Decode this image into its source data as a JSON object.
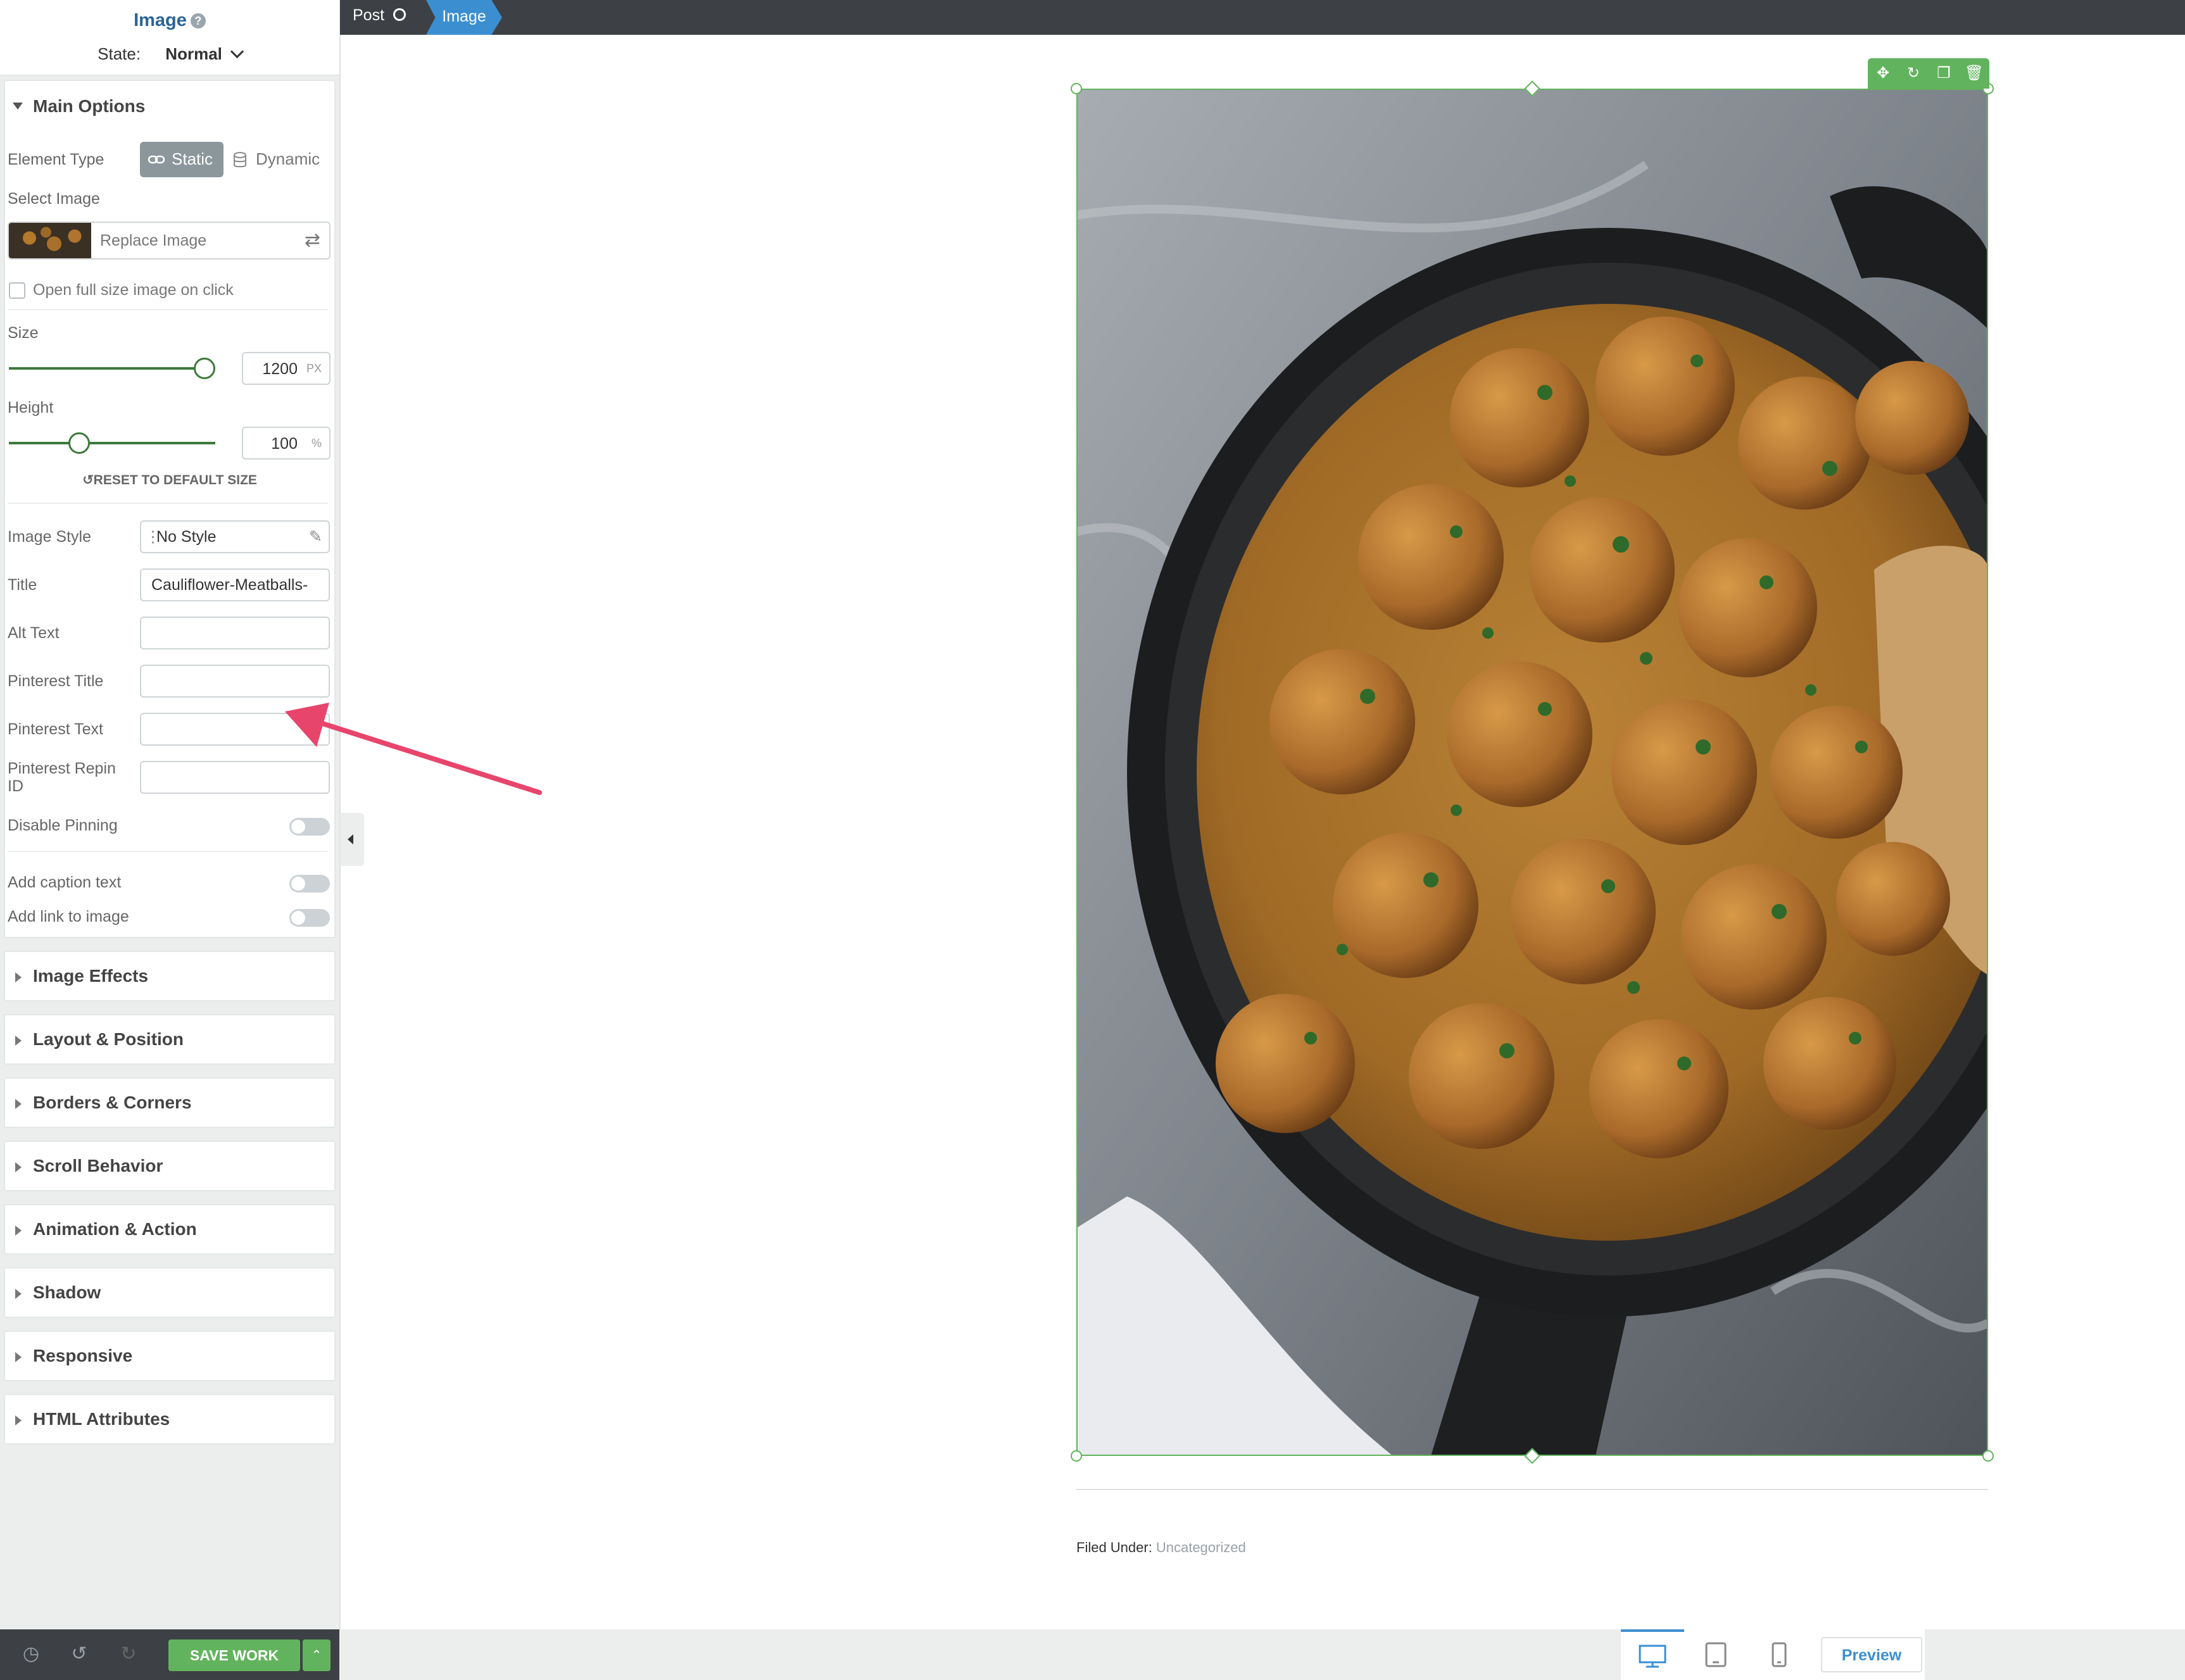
{
  "sidebar": {
    "title": "Image",
    "state_label": "State:",
    "state_value": "Normal",
    "main_options": {
      "title": "Main Options",
      "element_type_label": "Element Type",
      "static_label": "Static",
      "dynamic_label": "Dynamic",
      "select_image_label": "Select Image",
      "replace_image_label": "Replace Image",
      "open_full_size_label": "Open full size image on click",
      "size_label": "Size",
      "size_value": "1200",
      "size_unit": "PX",
      "height_label": "Height",
      "height_value": "100",
      "height_unit": "%",
      "reset_label": "RESET TO DEFAULT SIZE",
      "image_style_label": "Image Style",
      "image_style_value": "No Style",
      "title_label": "Title",
      "title_value": "Cauliflower-Meatballs-",
      "alt_text_label": "Alt Text",
      "pinterest_title_label": "Pinterest Title",
      "pinterest_text_label": "Pinterest Text",
      "pinterest_repin_label_line1": "Pinterest Repin",
      "pinterest_repin_label_line2": "ID",
      "disable_pinning_label": "Disable Pinning",
      "add_caption_label": "Add caption text",
      "add_link_label": "Add link to image"
    },
    "sections": [
      "Image Effects",
      "Layout & Position",
      "Borders & Corners",
      "Scroll Behavior",
      "Animation & Action",
      "Shadow",
      "Responsive",
      "HTML Attributes"
    ]
  },
  "topbar": {
    "breadcrumb_post": "Post",
    "breadcrumb_image": "Image"
  },
  "canvas": {
    "filed_under_label": "Filed Under:",
    "filed_under_category": "Uncategorized"
  },
  "bottombar": {
    "save_label": "SAVE WORK",
    "preview_label": "Preview"
  },
  "slider_levels": {
    "size_fraction": 0.94,
    "height_fraction": 0.32
  },
  "colors": {
    "accent_green": "#62b35d",
    "accent_blue": "#3b8fd1",
    "annotation_arrow": "#e8456c",
    "dark_bar": "#3d4145"
  }
}
